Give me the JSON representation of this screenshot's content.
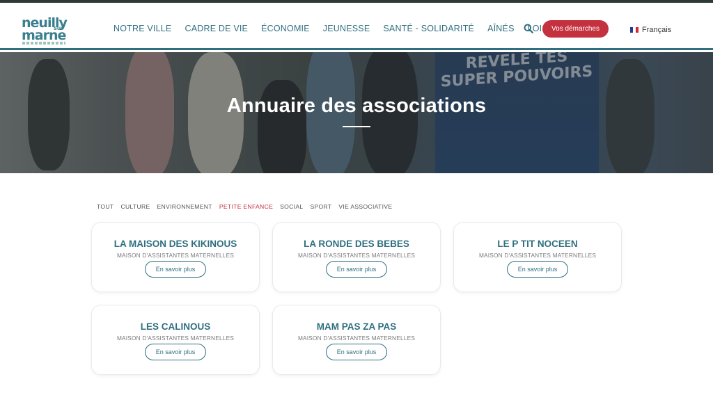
{
  "logo": {
    "line1": "neuilly",
    "line2": "sur",
    "line3": "marne"
  },
  "nav": {
    "items": [
      {
        "label": "NOTRE VILLE"
      },
      {
        "label": "CADRE DE VIE"
      },
      {
        "label": "ÉCONOMIE"
      },
      {
        "label": "JEUNESSE"
      },
      {
        "label": "SANTÉ - SOLIDARITÉ"
      },
      {
        "label": "AÎNÉS"
      },
      {
        "label": "LOISIRS"
      }
    ]
  },
  "header": {
    "search_icon": "search-icon",
    "cta_label": "Vos démarches",
    "language": "Français",
    "flag_icon": "french-flag-icon"
  },
  "hero": {
    "title": "Annuaire des associations",
    "poster_text": "REVELE TES SUPER POUVOIRS"
  },
  "filters": {
    "items": [
      {
        "label": "TOUT"
      },
      {
        "label": "CULTURE"
      },
      {
        "label": "ENVIRONNEMENT"
      },
      {
        "label": "PETITE ENFANCE"
      },
      {
        "label": "SOCIAL"
      },
      {
        "label": "SPORT"
      },
      {
        "label": "VIE ASSOCIATIVE"
      }
    ],
    "active": "PETITE ENFANCE"
  },
  "cards": [
    {
      "title": "LA MAISON DES KIKINOUS",
      "subtitle": "MAISON D'ASSISTANTES MATERNELLES",
      "button": "En savoir plus"
    },
    {
      "title": "LA RONDE DES BEBES",
      "subtitle": "MAISON D'ASSISTANTES MATERNELLES",
      "button": "En savoir plus"
    },
    {
      "title": "LE P TIT NOCEEN",
      "subtitle": "MAISON D'ASSISTANTES MATERNELLES",
      "button": "En savoir plus"
    },
    {
      "title": "LES CALINOUS",
      "subtitle": "MAISON D'ASSISTANTES MATERNELLES",
      "button": "En savoir plus"
    },
    {
      "title": "MAM PAS ZA PAS",
      "subtitle": "MAISON D'ASSISTANTES MATERNELLES",
      "button": "En savoir plus"
    }
  ],
  "colors": {
    "brand": "#2f6f80",
    "accent": "#c4323f",
    "topbar": "#2e3a36"
  }
}
